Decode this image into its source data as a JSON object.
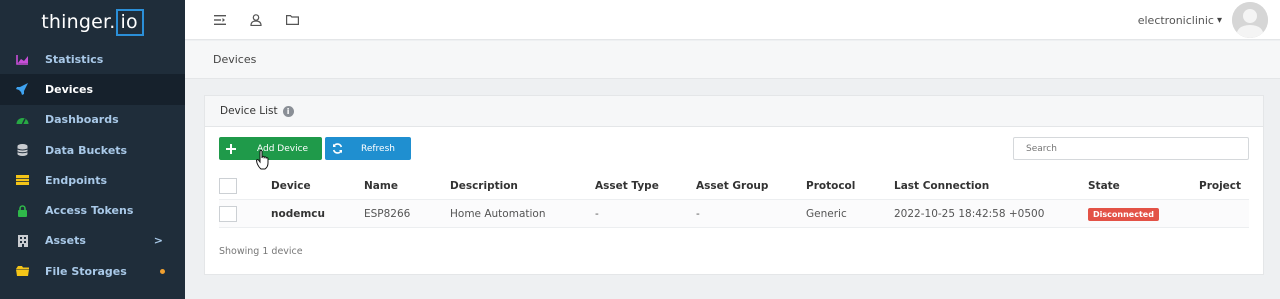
{
  "sidebar": {
    "logo_text": "thinger.",
    "logo_suffix": "io",
    "items": [
      {
        "label": "Statistics",
        "icon": "chart-icon",
        "color": "#c84ed8"
      },
      {
        "label": "Devices",
        "icon": "rocket-icon",
        "color": "#3fa3f0",
        "active": true
      },
      {
        "label": "Dashboards",
        "icon": "dashboard-icon",
        "color": "#27a844"
      },
      {
        "label": "Data Buckets",
        "icon": "database-icon",
        "color": "#c9ccd0"
      },
      {
        "label": "Endpoints",
        "icon": "endpoints-icon",
        "color": "#f5c518"
      },
      {
        "label": "Access Tokens",
        "icon": "lock-icon",
        "color": "#2fb84a"
      },
      {
        "label": "Assets",
        "icon": "building-icon",
        "color": "#c9ccd0",
        "arrow": ">"
      },
      {
        "label": "File Storages",
        "icon": "folder-icon",
        "color": "#f5c518",
        "dot": true
      }
    ]
  },
  "topbar": {
    "icons": [
      "sidebar-toggle-icon",
      "user-icon",
      "folder-icon"
    ],
    "username": "electroniclinic",
    "caret": "▾"
  },
  "breadcrumb": {
    "label": "Devices"
  },
  "panel": {
    "title": "Device List",
    "info": "i",
    "add_button": "Add Device",
    "refresh_button": "Refresh",
    "search_placeholder": "Search",
    "columns": [
      "Device",
      "Name",
      "Description",
      "Asset Type",
      "Asset Group",
      "Protocol",
      "Last Connection",
      "State",
      "Project"
    ],
    "rows": [
      {
        "Device": "nodemcu",
        "Name": "ESP8266",
        "Description": "Home Automation",
        "Asset Type": "-",
        "Asset Group": "-",
        "Protocol": "Generic",
        "Last Connection": "2022-10-25 18:42:58 +0500",
        "State": "Disconnected",
        "Project": ""
      }
    ],
    "footer": "Showing 1 device"
  },
  "colors": {
    "sidebar_bg": "#1f2d3a",
    "accent_blue": "#1f8fd0",
    "add_green": "#1f9a4a",
    "badge_red": "#e35246"
  }
}
